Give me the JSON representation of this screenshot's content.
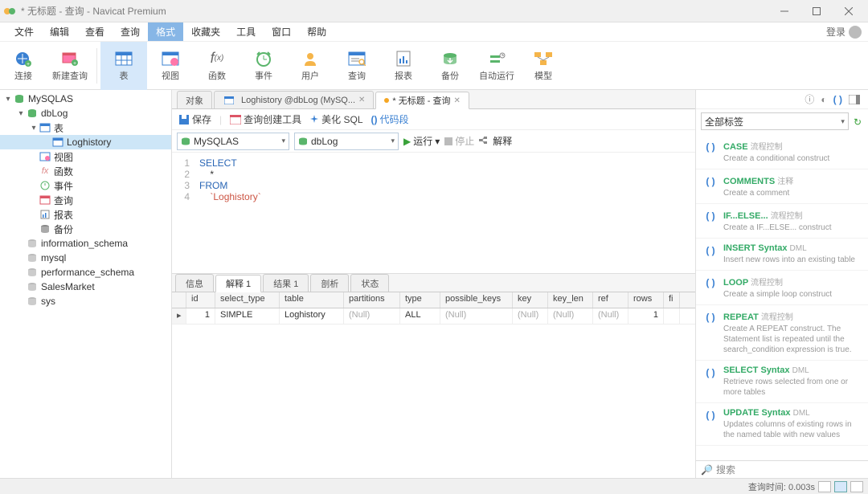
{
  "window": {
    "title": "* 无标题 - 查询 - Navicat Premium"
  },
  "menu": {
    "items": [
      "文件",
      "编辑",
      "查看",
      "查询",
      "格式",
      "收藏夹",
      "工具",
      "窗口",
      "帮助"
    ],
    "selected": 4,
    "login": "登录"
  },
  "toolbar": {
    "connect": "连接",
    "newquery": "新建查询",
    "table": "表",
    "view": "视图",
    "function": "函数",
    "event": "事件",
    "user": "用户",
    "query": "查询",
    "report": "报表",
    "backup": "备份",
    "autorun": "自动运行",
    "model": "模型",
    "active": "table"
  },
  "tree": {
    "conn": "MySQLAS",
    "db": "dbLog",
    "tables_label": "表",
    "tables": [
      "Loghistory"
    ],
    "views": "视图",
    "functions": "函数",
    "events": "事件",
    "queries": "查询",
    "reports": "报表",
    "backups": "备份",
    "other_dbs": [
      "information_schema",
      "mysql",
      "performance_schema",
      "SalesMarket",
      "sys"
    ]
  },
  "tabs": {
    "t1": "对象",
    "t2": "Loghistory @dbLog (MySQ...",
    "t3": "* 无标题 - 查询",
    "active": 2
  },
  "qbar": {
    "save": "保存",
    "builder": "查询创建工具",
    "beautify": "美化 SQL",
    "snippet": "代码段"
  },
  "connbar": {
    "conn": "MySQLAS",
    "db": "dbLog",
    "run": "运行",
    "stop": "停止",
    "explain": "解释"
  },
  "sql": {
    "l1": "SELECT",
    "l2": "*",
    "l3": "FROM",
    "l4": "`Loghistory`"
  },
  "result_tabs": {
    "t1": "信息",
    "t2": "解释 1",
    "t3": "结果 1",
    "t4": "剖析",
    "t5": "状态",
    "active": 1
  },
  "grid": {
    "cols": [
      "id",
      "select_type",
      "table",
      "partitions",
      "type",
      "possible_keys",
      "key",
      "key_len",
      "ref",
      "rows",
      "fi"
    ],
    "row": {
      "id": "1",
      "select_type": "SIMPLE",
      "table": "Loghistory",
      "partitions": "(Null)",
      "type": "ALL",
      "possible_keys": "(Null)",
      "key": "(Null)",
      "key_len": "(Null)",
      "ref": "(Null)",
      "rows": "1",
      "fi": ""
    }
  },
  "right": {
    "filter": "全部标签",
    "snippets": [
      {
        "name": "CASE",
        "tag": "流程控制",
        "desc": "Create a conditional construct"
      },
      {
        "name": "COMMENTS",
        "tag": "注释",
        "desc": "Create a comment"
      },
      {
        "name": "IF...ELSE...",
        "tag": "流程控制",
        "desc": "Create a IF...ELSE... construct"
      },
      {
        "name": "INSERT Syntax",
        "tag": "DML",
        "desc": "Insert new rows into an existing table"
      },
      {
        "name": "LOOP",
        "tag": "流程控制",
        "desc": "Create a simple loop construct"
      },
      {
        "name": "REPEAT",
        "tag": "流程控制",
        "desc": "Create A REPEAT construct. The Statement list is repeated until the search_condition expression is true."
      },
      {
        "name": "SELECT Syntax",
        "tag": "DML",
        "desc": "Retrieve rows selected from one or more tables"
      },
      {
        "name": "UPDATE Syntax",
        "tag": "DML",
        "desc": "Updates columns of existing rows in the named table with new values"
      }
    ],
    "search": "搜索"
  },
  "status": {
    "time": "查询时间: 0.003s"
  }
}
